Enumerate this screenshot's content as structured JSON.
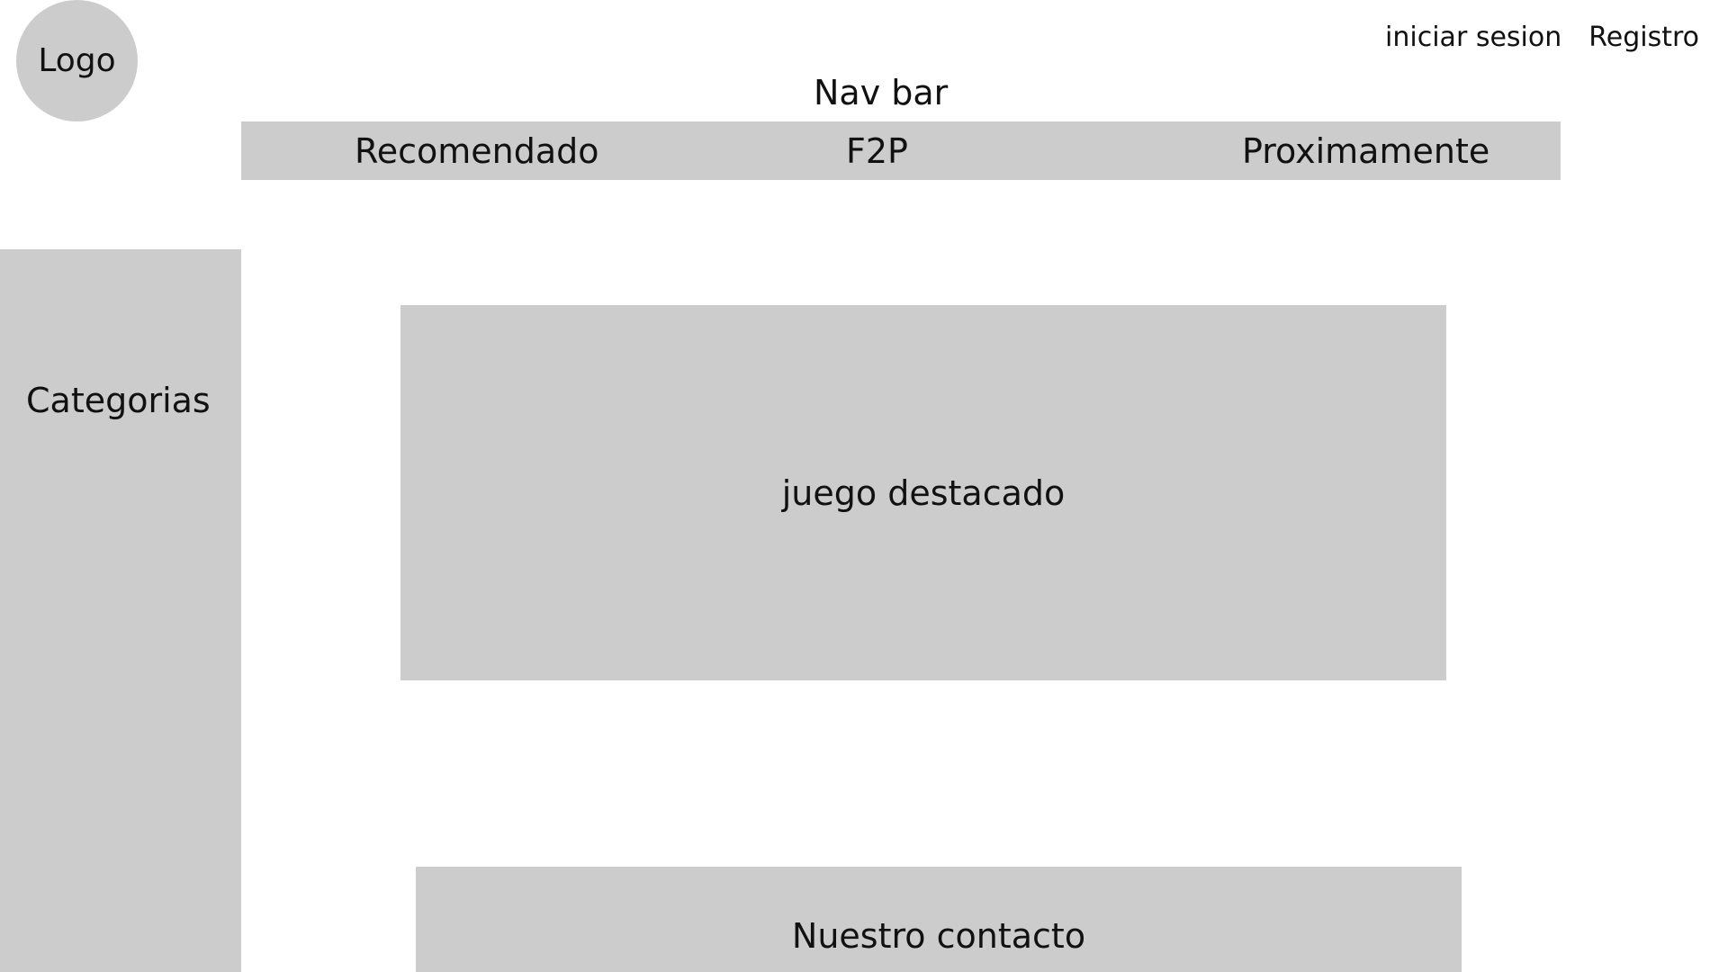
{
  "header": {
    "logo_label": "Logo",
    "auth": {
      "login_label": "iniciar sesion",
      "register_label": "Registro"
    }
  },
  "navbar": {
    "caption": "Nav bar",
    "items": [
      {
        "label": "Recomendado"
      },
      {
        "label": "F2P"
      },
      {
        "label": "Proximamente"
      }
    ]
  },
  "sidebar": {
    "title": "Categorias"
  },
  "main": {
    "featured_label": "juego destacado"
  },
  "footer": {
    "contact_label": "Nuestro contacto"
  },
  "colors": {
    "placeholder_gray": "#cccccc",
    "text": "#111111",
    "background": "#ffffff"
  }
}
